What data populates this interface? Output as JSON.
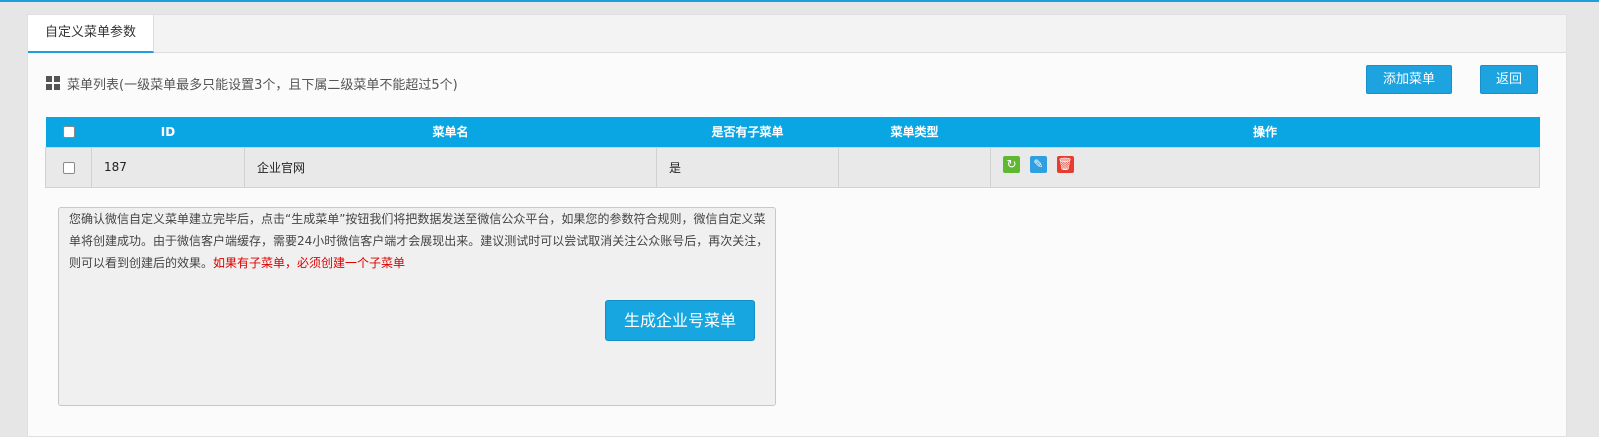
{
  "tab": {
    "label": "自定义菜单参数"
  },
  "list": {
    "title": "菜单列表(一级菜单最多只能设置3个，且下属二级菜单不能超过5个)"
  },
  "toolbar": {
    "add_label": "添加菜单",
    "back_label": "返回"
  },
  "table": {
    "headers": [
      "ID",
      "菜单名",
      "是否有子菜单",
      "菜单类型",
      "操作"
    ],
    "rows": [
      {
        "id": "187",
        "name": "企业官网",
        "has_sub": "是",
        "type": ""
      }
    ]
  },
  "notice": {
    "text": "您确认微信自定义菜单建立完毕后，点击“生成菜单”按钮我们将把数据发送至微信公众平台，如果您的参数符合规则，微信自定义菜单将创建成功。由于微信客户端缓存，需要24小时微信客户端才会展现出来。建议测试时可以尝试取消关注公众账号后，再次关注，则可以看到创建后的效果。",
    "warning": "如果有子菜单，必须创建一个子菜单",
    "button_label": "生成企业号菜单"
  },
  "colors": {
    "accent": "#1ca3e0",
    "header": "#0aa5e3",
    "warning": "#dd0000"
  },
  "icons": [
    "grid-icon",
    "refresh-icon",
    "edit-icon",
    "delete-icon"
  ]
}
